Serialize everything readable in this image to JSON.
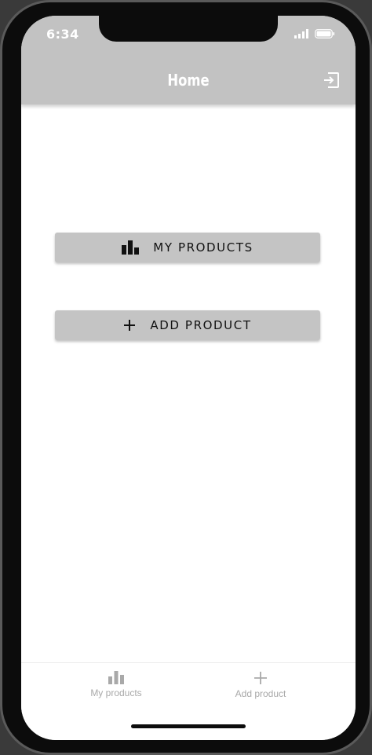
{
  "status_bar": {
    "time": "6:34"
  },
  "header": {
    "title": "Home",
    "logout_icon": "logout-icon"
  },
  "main": {
    "buttons": [
      {
        "label": "MY PRODUCTS",
        "icon": "bar-chart-icon"
      },
      {
        "label": "ADD PRODUCT",
        "icon": "plus-icon"
      }
    ]
  },
  "tabbar": {
    "tabs": [
      {
        "label": "My products",
        "icon": "bar-chart-icon"
      },
      {
        "label": "Add product",
        "icon": "plus-icon"
      }
    ]
  },
  "colors": {
    "header_bg": "#c2c2c2",
    "button_bg": "#c4c4c4",
    "tab_inactive": "#a9a9a9",
    "device_frame": "#0c0c0c"
  }
}
